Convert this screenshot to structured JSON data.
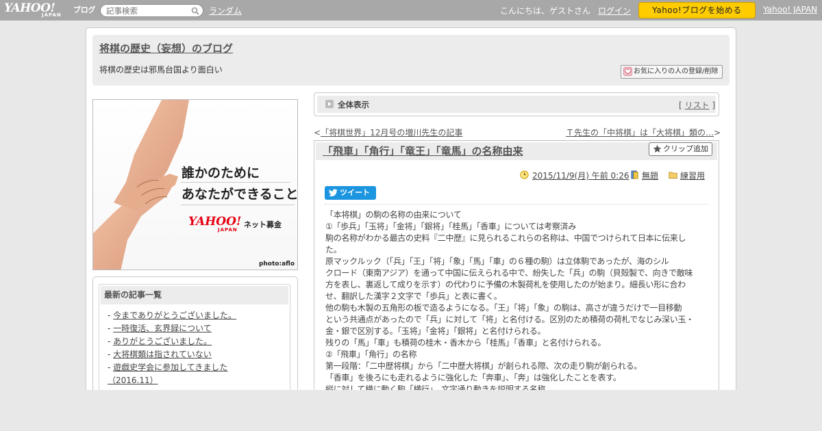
{
  "topbar": {
    "logo_yahoo": "YAHOO!",
    "logo_japan": "JAPAN",
    "logo_blog": "ブログ",
    "search_placeholder": "記事検索",
    "random_link": "ランダム",
    "greeting": "こんにちは、ゲストさん",
    "login_link": "ログイン",
    "start_button": "Yahoo!ブログを始める",
    "yahoo_japan_link": "Yahoo! JAPAN"
  },
  "blog": {
    "title": "将棋の歴史（妄想）のブログ",
    "description": "将棋の歴史は邪馬台国より面白い",
    "favorite_button": "お気に入りの人の登録/削除"
  },
  "ad": {
    "line1": "誰かのために",
    "line2": "あなたができること",
    "brand": "YAHOO!",
    "brand_japan": "JAPAN",
    "service": "ネット募金",
    "credit": "photo:aflo"
  },
  "recent": {
    "title": "最新の記事一覧",
    "items": [
      "今までありがとうございました。",
      "一時復活、玄界録について",
      "ありがとうございました。",
      "大将棋類は指されていない",
      "遊戯史学会に参加してきました",
      "（2016.11）"
    ]
  },
  "view": {
    "label": "全体表示",
    "list_open": "[ ",
    "list_link": "リスト",
    "list_close": " ]"
  },
  "nav": {
    "prev": "「将棋世界」12月号の増川先生の記事",
    "next": "Ｔ先生の「中将棋」は「大将棋」類の…"
  },
  "article": {
    "title": "「飛車」「角行」「竜王」「竜馬」の名称由来",
    "clip_button": "クリップ追加",
    "date": "2015/11/9(月) 午前 0:26",
    "theme": "無題",
    "category": "練習用",
    "tweet_button": "ツイート",
    "body_lines": [
      "「本将棋」の駒の名称の由来について",
      "①「歩兵」「玉将」「金将」「銀将」「桂馬」「香車」については考察済み",
      "駒の名称がわかる最古の史料『二中歴』に見られるこれらの名称は、中国でつけられて日本に伝来し",
      "た。",
      "原マックルック（「兵」「王」「将」「象」「馬」「車」の６種の駒）は立体駒であったが、海のシル",
      "クロード（東南アジア）を通って中国に伝えられる中で、紛失した「兵」の駒（貝殻製で、向きで敵味",
      "方を表し、裏返して成りを示す）の代わりに予備の木製荷札を使用したのが始まり。細長い形に合わ",
      "せ、翻訳した漢字２文字で「歩兵」と表に書く。",
      "他の駒も木製の五角形の板で造るようになる。「王」「将」「象」の駒は、高さが違うだけで一目移動",
      "という共通点があったので「兵」に対して「将」と名付ける。区別のため積荷の荷札でなじみ深い玉・",
      "金・銀で区別する。「玉将」「金将」「銀将」と名付けられる。",
      "残りの「馬」「車」も積荷の桂木・香木から「桂馬」「香車」と名付けられる。",
      "②「飛車」「角行」の名称",
      "第一段階：「二中歴将棋」から「二中歴大将棋」が創られる際、次の走り駒が創られる。",
      "「香車」を後ろにも走れるように強化した「奔車」、「奔」は強化したことを表す。",
      "縦に対して横に動く駒「横行」、文字通り動きを説明する名称。"
    ]
  },
  "colors": {
    "topbar": "#a8a8a8",
    "start_button": "#ffcc00",
    "tweet": "#1b95e0",
    "ad_brand": "#e60012"
  },
  "icons": [
    "search-icon",
    "heart-icon",
    "arrow-icon",
    "star-icon",
    "clock-icon",
    "book-icon",
    "folder-icon",
    "twitter-bird-icon"
  ]
}
